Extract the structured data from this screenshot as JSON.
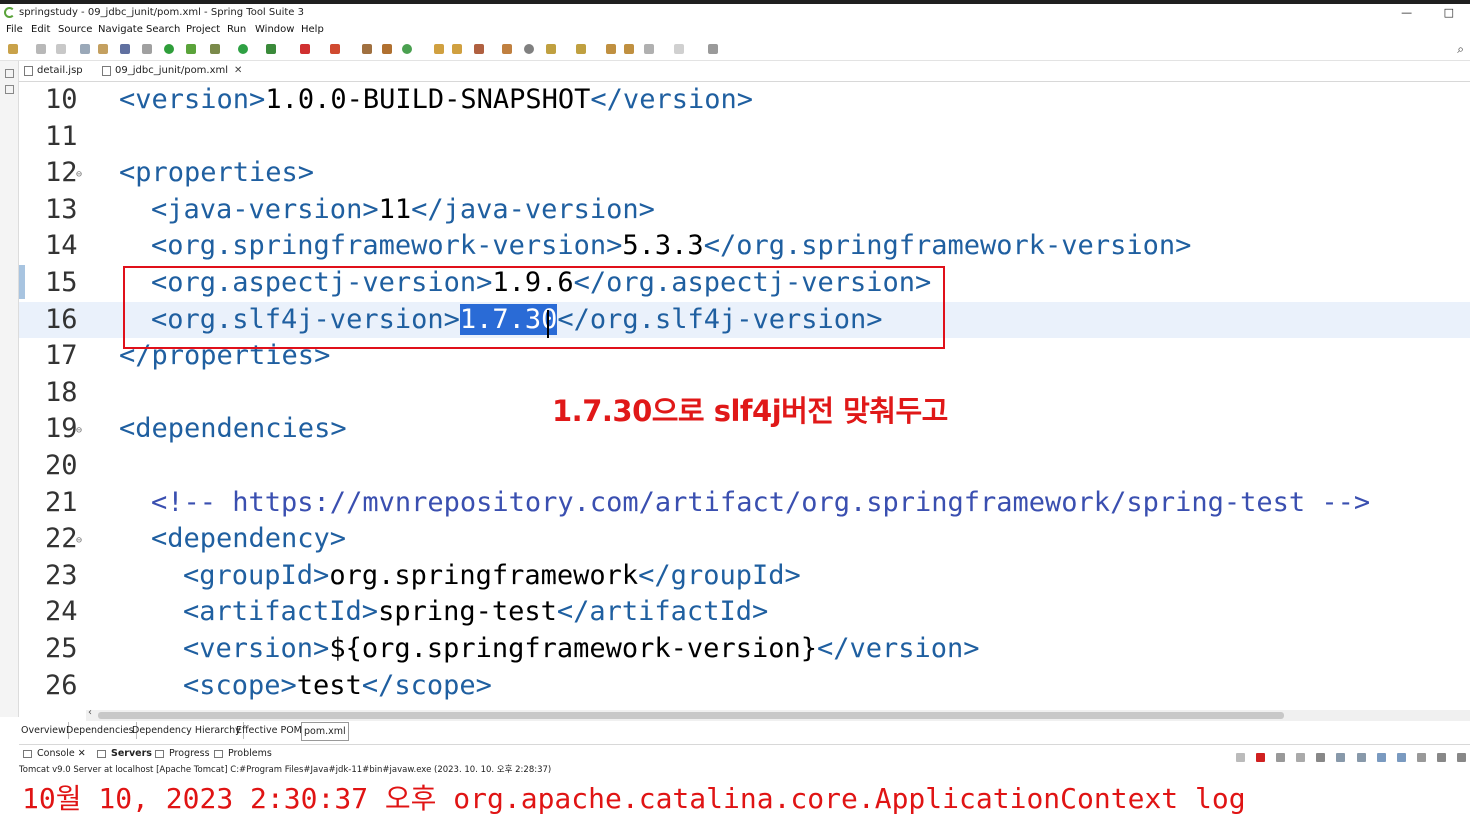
{
  "window": {
    "title": "springstudy - 09_jdbc_junit/pom.xml - Spring Tool Suite 3"
  },
  "menu": [
    "File",
    "Edit",
    "Source",
    "Navigate",
    "Search",
    "Project",
    "Run",
    "Window",
    "Help"
  ],
  "editor_tabs": [
    {
      "label": "detail.jsp",
      "active": false
    },
    {
      "label": "09_jdbc_junit/pom.xml",
      "active": true
    }
  ],
  "editor_lines": [
    {
      "num": "10",
      "fold": "",
      "indent": 0,
      "parts": [
        [
          "tag",
          "<version>"
        ],
        [
          "txt",
          "1.0.0-BUILD-SNAPSHOT"
        ],
        [
          "tag",
          "</version>"
        ]
      ]
    },
    {
      "num": "11",
      "fold": "",
      "indent": 0,
      "parts": []
    },
    {
      "num": "12",
      "fold": "⊖",
      "indent": 0,
      "parts": [
        [
          "tag",
          "<properties>"
        ]
      ]
    },
    {
      "num": "13",
      "fold": "",
      "indent": 1,
      "parts": [
        [
          "tag",
          "<java-version>"
        ],
        [
          "txt",
          "11"
        ],
        [
          "tag",
          "</java-version>"
        ]
      ]
    },
    {
      "num": "14",
      "fold": "",
      "indent": 1,
      "parts": [
        [
          "tag",
          "<org.springframework-version>"
        ],
        [
          "txt",
          "5.3.3"
        ],
        [
          "tag",
          "</org.springframework-version>"
        ]
      ]
    },
    {
      "num": "15",
      "fold": "",
      "indent": 1,
      "parts": [
        [
          "tag",
          "<org.aspectj-version>"
        ],
        [
          "txt",
          "1.9.6"
        ],
        [
          "tag",
          "</org.aspectj-version>"
        ]
      ]
    },
    {
      "num": "16",
      "fold": "",
      "indent": 1,
      "current": true,
      "parts": [
        [
          "tag",
          "<org.slf4j-version>"
        ],
        [
          "sel",
          "1.7.30"
        ],
        [
          "tag",
          "</org.slf4j-version>"
        ]
      ]
    },
    {
      "num": "17",
      "fold": "",
      "indent": 0,
      "parts": [
        [
          "tag",
          "</properties>"
        ]
      ]
    },
    {
      "num": "18",
      "fold": "",
      "indent": 0,
      "parts": []
    },
    {
      "num": "19",
      "fold": "⊖",
      "indent": 0,
      "parts": [
        [
          "tag",
          "<dependencies>"
        ]
      ]
    },
    {
      "num": "20",
      "fold": "",
      "indent": 0,
      "parts": []
    },
    {
      "num": "21",
      "fold": "",
      "indent": 1,
      "parts": [
        [
          "cm",
          "<!-- https://mvnrepository.com/artifact/org.springframework/spring-test -->"
        ]
      ]
    },
    {
      "num": "22",
      "fold": "⊖",
      "indent": 1,
      "parts": [
        [
          "tag",
          "<dependency>"
        ]
      ]
    },
    {
      "num": "23",
      "fold": "",
      "indent": 2,
      "parts": [
        [
          "tag",
          "<groupId>"
        ],
        [
          "txt",
          "org.springframework"
        ],
        [
          "tag",
          "</groupId>"
        ]
      ]
    },
    {
      "num": "24",
      "fold": "",
      "indent": 2,
      "parts": [
        [
          "tag",
          "<artifactId>"
        ],
        [
          "txt",
          "spring-test"
        ],
        [
          "tag",
          "</artifactId>"
        ]
      ]
    },
    {
      "num": "25",
      "fold": "",
      "indent": 2,
      "parts": [
        [
          "tag",
          "<version>"
        ],
        [
          "txt",
          "${org.springframework-version}"
        ],
        [
          "tag",
          "</version>"
        ]
      ]
    },
    {
      "num": "26",
      "fold": "",
      "indent": 2,
      "parts": [
        [
          "tag",
          "<scope>"
        ],
        [
          "txt",
          "test"
        ],
        [
          "tag",
          "</scope>"
        ]
      ]
    }
  ],
  "annotation": "1.7.30으로 slf4j버전 맞춰두고",
  "pom_tabs": [
    "Overview",
    "Dependencies",
    "Dependency Hierarchy",
    "Effective POM",
    "pom.xml"
  ],
  "bottom_tabs": {
    "console": "Console",
    "servers": "Servers",
    "progress": "Progress",
    "problems": "Problems"
  },
  "console_header": "Tomcat v9.0 Server at localhost [Apache Tomcat] C:#Program Files#Java#jdk-11#bin#javaw.exe  (2023. 10. 10. 오후 2:28:37)",
  "console_lines": [
    "10월 10, 2023 2:30:37 오후 org.apache.catalina.core.ApplicationContext log"
  ],
  "colors": {
    "tag": "#1f5fa0",
    "highlight_box": "#e0101a",
    "annotation": "#e01818",
    "selection": "#2a6bd6"
  }
}
